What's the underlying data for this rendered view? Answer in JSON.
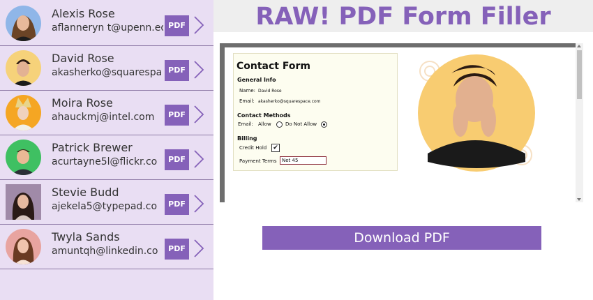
{
  "app": {
    "title": "RAW! PDF Form Filler"
  },
  "contacts": [
    {
      "name": "Alexis Rose",
      "email": "aflanneryn t@upenn.ed",
      "pdf_label": "PDF"
    },
    {
      "name": "David Rose",
      "email": "akasherko@squarespa",
      "pdf_label": "PDF"
    },
    {
      "name": "Moira Rose",
      "email": "ahauckmj@intel.com",
      "pdf_label": "PDF"
    },
    {
      "name": "Patrick Brewer",
      "email": "acurtayne5l@flickr.co",
      "pdf_label": "PDF"
    },
    {
      "name": "Stevie Budd",
      "email": "ajekela5@typepad.co",
      "pdf_label": "PDF"
    },
    {
      "name": "Twyla Sands",
      "email": "amuntqh@linkedin.co",
      "pdf_label": "PDF"
    }
  ],
  "form": {
    "title": "Contact Form",
    "general_info": "General Info",
    "name_label": "Name:",
    "name_value": "David Rose",
    "email_label": "Email:",
    "email_value": "akasherko@squarespace.com",
    "contact_methods": "Contact Methods",
    "method_email_label": "Email:",
    "allow_label": "Allow",
    "do_not_allow_label": "Do Not Allow",
    "billing": "Billing",
    "credit_hold_label": "Credit Hold",
    "credit_hold_mark": "✔",
    "payment_terms_label": "Payment Terms",
    "payment_terms_value": "Net 45"
  },
  "download_label": "Download PDF",
  "colors": {
    "accent": "#8561b9",
    "sidebar_bg": "#e9def3",
    "form_bg": "#fdfdf0"
  }
}
